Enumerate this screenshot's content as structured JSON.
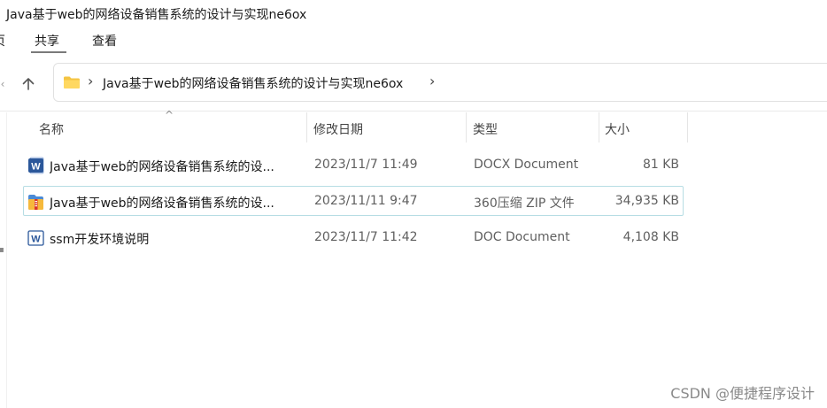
{
  "window": {
    "title": "Java基于web的网络设备销售系统的设计与实现ne6ox"
  },
  "ribbon": {
    "tabs": [
      {
        "label": "页"
      },
      {
        "label": "共享"
      },
      {
        "label": "查看"
      }
    ]
  },
  "nav": {
    "up_icon": "up-arrow-icon",
    "breadcrumb": "Java基于web的网络设备销售系统的设计与实现ne6ox"
  },
  "columns": {
    "name": "名称",
    "date": "修改日期",
    "type": "类型",
    "size": "大小"
  },
  "files": [
    {
      "name": "Java基于web的网络设备销售系统的设...",
      "date": "2023/11/7 11:49",
      "type": "DOCX Document",
      "size": "81 KB",
      "icon": "word-icon"
    },
    {
      "name": "Java基于web的网络设备销售系统的设...",
      "date": "2023/11/11 9:47",
      "type": "360压缩 ZIP 文件",
      "size": "34,935 KB",
      "icon": "zip-archive-icon"
    },
    {
      "name": "ssm开发环境说明",
      "date": "2023/11/7 11:42",
      "type": "DOC Document",
      "size": "4,108 KB",
      "icon": "word-icon"
    }
  ],
  "colors": {
    "word_blue": "#2b579a",
    "selection_border": "#b7dde4",
    "folder_yellow": "#f4c443"
  },
  "watermark": "CSDN @便捷程序设计"
}
